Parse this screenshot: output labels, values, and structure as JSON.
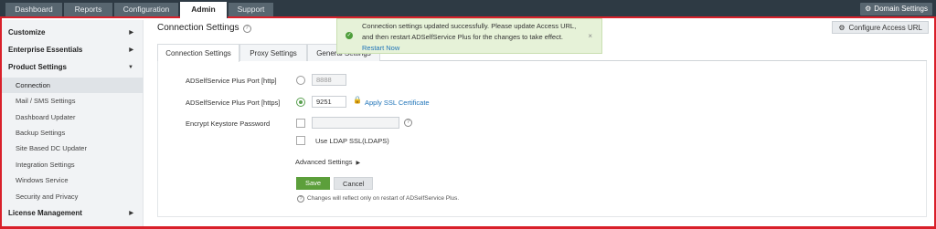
{
  "topnav": {
    "tabs": [
      "Dashboard",
      "Reports",
      "Configuration",
      "Admin",
      "Support"
    ],
    "active_tab": "Admin",
    "domain_settings": "Domain Settings"
  },
  "sidebar": {
    "customize": "Customize",
    "enterprise": "Enterprise Essentials",
    "product_settings": "Product Settings",
    "items": [
      "Connection",
      "Mail / SMS Settings",
      "Dashboard Updater",
      "Backup Settings",
      "Site Based DC Updater",
      "Integration Settings",
      "Windows Service",
      "Security and Privacy"
    ],
    "license": "License Management"
  },
  "main": {
    "title": "Connection Settings",
    "configure_access_url": "Configure Access URL",
    "subtabs": [
      "Connection Settings",
      "Proxy Settings",
      "General Settings"
    ],
    "http_label": "ADSelfService Plus Port [http]",
    "http_value": "8888",
    "https_label": "ADSelfService Plus Port [https]",
    "https_value": "9251",
    "apply_ssl": "Apply SSL Certificate",
    "keystore_label": "Encrypt Keystore Password",
    "keystore_value": "",
    "ldap_label": "Use LDAP SSL(LDAPS)",
    "advanced": "Advanced Settings",
    "save": "Save",
    "cancel": "Cancel",
    "note": "Changes will reflect only on restart of ADSelfService Plus."
  },
  "toast": {
    "message": "Connection settings updated successfully. Please update Access URL, and then restart ADSelfService Plus for the changes to take effect.",
    "link": "Restart Now"
  },
  "colors": {
    "topbar": "#2e3a44",
    "accent_red": "#d9202a",
    "save_green": "#5c9f3b",
    "link_blue": "#1e73b8"
  }
}
